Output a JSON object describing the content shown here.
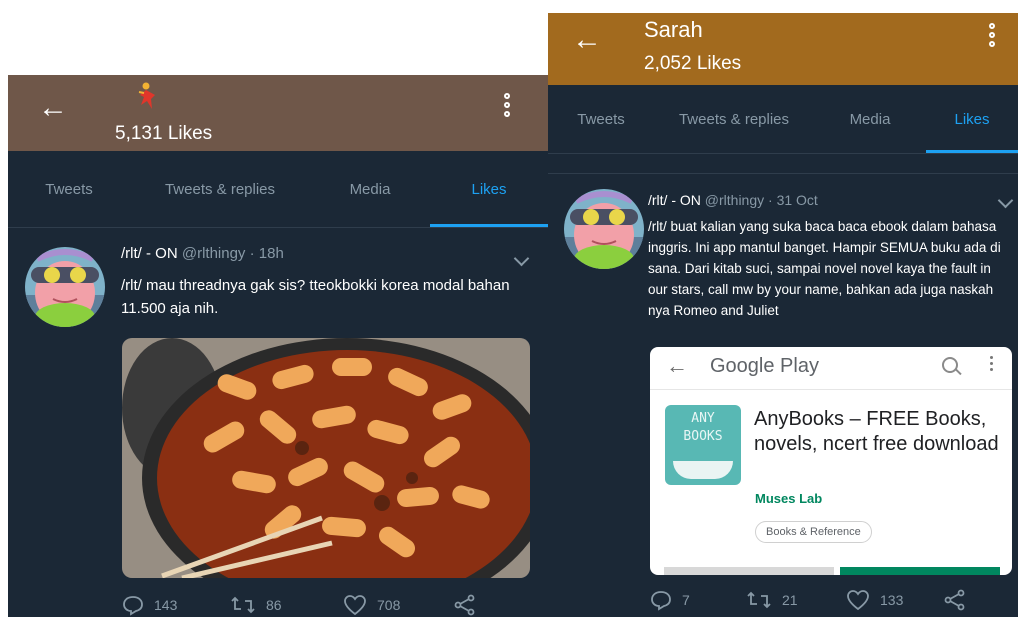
{
  "left_profile": {
    "likes_count": "5,131 Likes",
    "tabs": [
      {
        "label": "Tweets",
        "active": false
      },
      {
        "label": "Tweets & replies",
        "active": false
      },
      {
        "label": "Media",
        "active": false
      },
      {
        "label": "Likes",
        "active": true
      }
    ],
    "tweet": {
      "author": "/rlt/ - ON",
      "handle": "@rlthingy",
      "time": "· 18h",
      "text": "/rlt/ mau threadnya gak sis? tteokbokki korea modal bahan 11.500 aja nih.",
      "replies": "143",
      "retweets": "86",
      "likes": "708"
    }
  },
  "right_profile": {
    "name": "Sarah",
    "likes_count": "2,052 Likes",
    "tabs": [
      {
        "label": "Tweets",
        "active": false
      },
      {
        "label": "Tweets & replies",
        "active": false
      },
      {
        "label": "Media",
        "active": false
      },
      {
        "label": "Likes",
        "active": true
      }
    ],
    "tweet": {
      "author": "/rlt/ - ON",
      "handle": "@rlthingy",
      "time": "· 31 Oct",
      "text": "/rlt/ buat kalian yang suka baca baca ebook dalam bahasa inggris. Ini app mantul banget. Hampir SEMUA buku ada di sana. Dari kitab suci, sampai novel novel kaya the fault in our stars, call mw by your name, bahkan ada juga naskah nya Romeo and Juliet",
      "replies": "7",
      "retweets": "21",
      "likes": "133"
    },
    "embedded_card": {
      "store_title": "Google Play",
      "icon_text_line1": "ANY",
      "icon_text_line2": "BOOKS",
      "app_name": "AnyBooks – FREE Books, novels, ncert free download",
      "developer": "Muses Lab",
      "category": "Books & Reference"
    }
  },
  "icons": [
    "back-arrow-icon",
    "more-vert-icon",
    "chevron-down-icon",
    "reply-icon",
    "retweet-icon",
    "like-icon",
    "share-icon",
    "search-icon"
  ],
  "colors": {
    "left_header": "#6f5749",
    "right_header": "#a26a1e",
    "background": "#1b2836",
    "accent": "#1da1f2",
    "muted": "#8899a6",
    "developer_green": "#01875f"
  }
}
